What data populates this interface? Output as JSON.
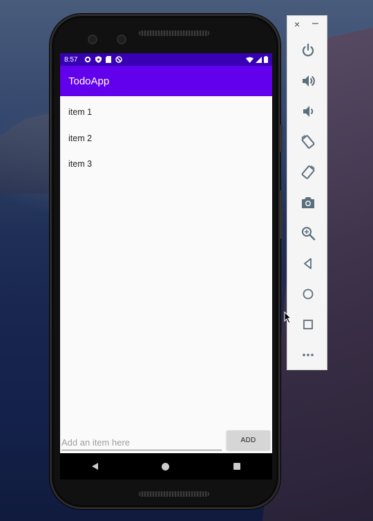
{
  "status_bar": {
    "time": "8:57",
    "icons": [
      "gear-icon",
      "shield-icon",
      "sd-card-icon",
      "no-disturb-icon"
    ],
    "right_icons": [
      "wifi-icon",
      "signal-icon",
      "battery-icon"
    ]
  },
  "app": {
    "title": "TodoApp",
    "items": [
      "item 1",
      "item 2",
      "item 3"
    ],
    "input_placeholder": "Add an item here",
    "add_button_label": "ADD",
    "colors": {
      "status_bar": "#3700b3",
      "toolbar": "#6200ee",
      "background": "#fafafa"
    }
  },
  "nav_bar": {
    "buttons": [
      "back-icon",
      "home-icon",
      "recents-icon"
    ]
  },
  "emulator_panel": {
    "tools": [
      "power-icon",
      "volume-up-icon",
      "volume-down-icon",
      "rotate-left-icon",
      "rotate-right-icon",
      "camera-icon",
      "zoom-icon",
      "back-icon",
      "home-icon",
      "overview-icon",
      "more-icon"
    ]
  }
}
